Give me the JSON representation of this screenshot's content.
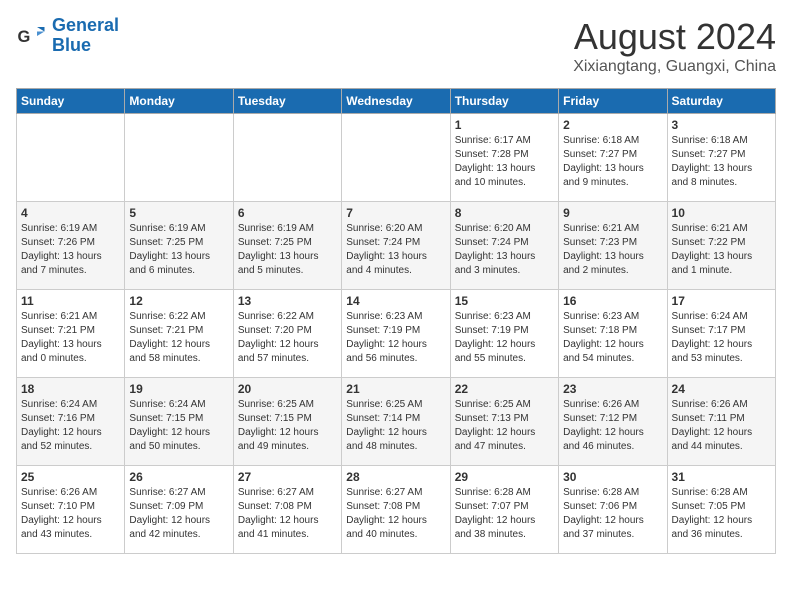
{
  "header": {
    "logo_general": "General",
    "logo_blue": "Blue",
    "month_year": "August 2024",
    "location": "Xixiangtang, Guangxi, China"
  },
  "weekdays": [
    "Sunday",
    "Monday",
    "Tuesday",
    "Wednesday",
    "Thursday",
    "Friday",
    "Saturday"
  ],
  "weeks": [
    [
      {
        "day": "",
        "info": ""
      },
      {
        "day": "",
        "info": ""
      },
      {
        "day": "",
        "info": ""
      },
      {
        "day": "",
        "info": ""
      },
      {
        "day": "1",
        "info": "Sunrise: 6:17 AM\nSunset: 7:28 PM\nDaylight: 13 hours and 10 minutes."
      },
      {
        "day": "2",
        "info": "Sunrise: 6:18 AM\nSunset: 7:27 PM\nDaylight: 13 hours and 9 minutes."
      },
      {
        "day": "3",
        "info": "Sunrise: 6:18 AM\nSunset: 7:27 PM\nDaylight: 13 hours and 8 minutes."
      }
    ],
    [
      {
        "day": "4",
        "info": "Sunrise: 6:19 AM\nSunset: 7:26 PM\nDaylight: 13 hours and 7 minutes."
      },
      {
        "day": "5",
        "info": "Sunrise: 6:19 AM\nSunset: 7:25 PM\nDaylight: 13 hours and 6 minutes."
      },
      {
        "day": "6",
        "info": "Sunrise: 6:19 AM\nSunset: 7:25 PM\nDaylight: 13 hours and 5 minutes."
      },
      {
        "day": "7",
        "info": "Sunrise: 6:20 AM\nSunset: 7:24 PM\nDaylight: 13 hours and 4 minutes."
      },
      {
        "day": "8",
        "info": "Sunrise: 6:20 AM\nSunset: 7:24 PM\nDaylight: 13 hours and 3 minutes."
      },
      {
        "day": "9",
        "info": "Sunrise: 6:21 AM\nSunset: 7:23 PM\nDaylight: 13 hours and 2 minutes."
      },
      {
        "day": "10",
        "info": "Sunrise: 6:21 AM\nSunset: 7:22 PM\nDaylight: 13 hours and 1 minute."
      }
    ],
    [
      {
        "day": "11",
        "info": "Sunrise: 6:21 AM\nSunset: 7:21 PM\nDaylight: 13 hours and 0 minutes."
      },
      {
        "day": "12",
        "info": "Sunrise: 6:22 AM\nSunset: 7:21 PM\nDaylight: 12 hours and 58 minutes."
      },
      {
        "day": "13",
        "info": "Sunrise: 6:22 AM\nSunset: 7:20 PM\nDaylight: 12 hours and 57 minutes."
      },
      {
        "day": "14",
        "info": "Sunrise: 6:23 AM\nSunset: 7:19 PM\nDaylight: 12 hours and 56 minutes."
      },
      {
        "day": "15",
        "info": "Sunrise: 6:23 AM\nSunset: 7:19 PM\nDaylight: 12 hours and 55 minutes."
      },
      {
        "day": "16",
        "info": "Sunrise: 6:23 AM\nSunset: 7:18 PM\nDaylight: 12 hours and 54 minutes."
      },
      {
        "day": "17",
        "info": "Sunrise: 6:24 AM\nSunset: 7:17 PM\nDaylight: 12 hours and 53 minutes."
      }
    ],
    [
      {
        "day": "18",
        "info": "Sunrise: 6:24 AM\nSunset: 7:16 PM\nDaylight: 12 hours and 52 minutes."
      },
      {
        "day": "19",
        "info": "Sunrise: 6:24 AM\nSunset: 7:15 PM\nDaylight: 12 hours and 50 minutes."
      },
      {
        "day": "20",
        "info": "Sunrise: 6:25 AM\nSunset: 7:15 PM\nDaylight: 12 hours and 49 minutes."
      },
      {
        "day": "21",
        "info": "Sunrise: 6:25 AM\nSunset: 7:14 PM\nDaylight: 12 hours and 48 minutes."
      },
      {
        "day": "22",
        "info": "Sunrise: 6:25 AM\nSunset: 7:13 PM\nDaylight: 12 hours and 47 minutes."
      },
      {
        "day": "23",
        "info": "Sunrise: 6:26 AM\nSunset: 7:12 PM\nDaylight: 12 hours and 46 minutes."
      },
      {
        "day": "24",
        "info": "Sunrise: 6:26 AM\nSunset: 7:11 PM\nDaylight: 12 hours and 44 minutes."
      }
    ],
    [
      {
        "day": "25",
        "info": "Sunrise: 6:26 AM\nSunset: 7:10 PM\nDaylight: 12 hours and 43 minutes."
      },
      {
        "day": "26",
        "info": "Sunrise: 6:27 AM\nSunset: 7:09 PM\nDaylight: 12 hours and 42 minutes."
      },
      {
        "day": "27",
        "info": "Sunrise: 6:27 AM\nSunset: 7:08 PM\nDaylight: 12 hours and 41 minutes."
      },
      {
        "day": "28",
        "info": "Sunrise: 6:27 AM\nSunset: 7:08 PM\nDaylight: 12 hours and 40 minutes."
      },
      {
        "day": "29",
        "info": "Sunrise: 6:28 AM\nSunset: 7:07 PM\nDaylight: 12 hours and 38 minutes."
      },
      {
        "day": "30",
        "info": "Sunrise: 6:28 AM\nSunset: 7:06 PM\nDaylight: 12 hours and 37 minutes."
      },
      {
        "day": "31",
        "info": "Sunrise: 6:28 AM\nSunset: 7:05 PM\nDaylight: 12 hours and 36 minutes."
      }
    ]
  ]
}
